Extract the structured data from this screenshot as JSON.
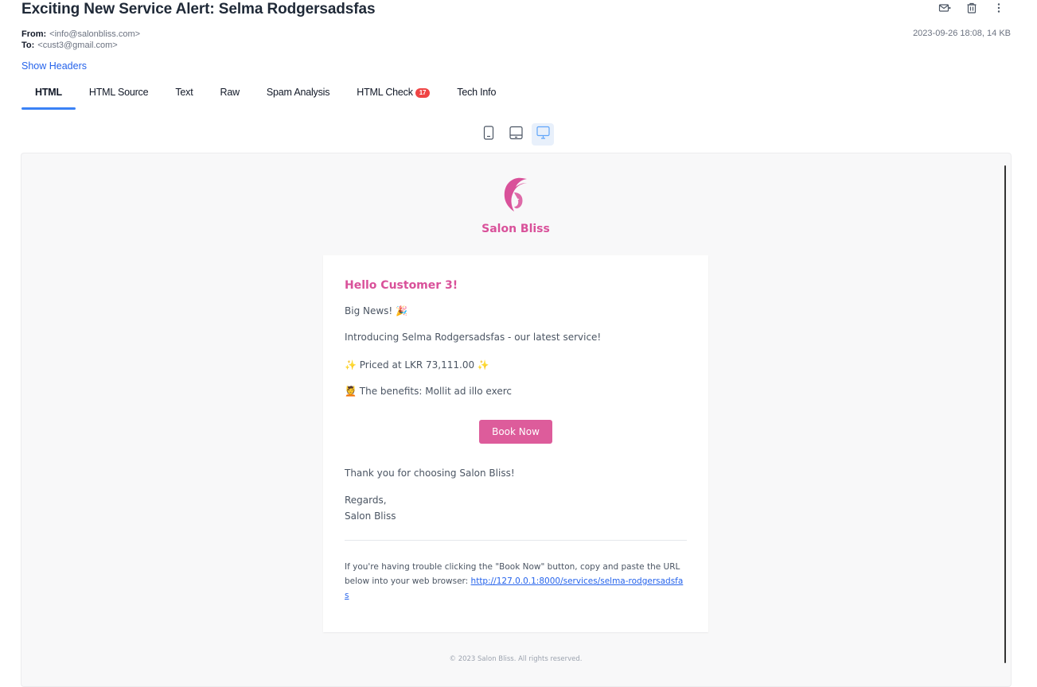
{
  "email": {
    "subject": "Exciting New Service Alert: Selma Rodgersadsfas",
    "from_label": "From:",
    "from_value": "<info@salonbliss.com>",
    "to_label": "To:",
    "to_value": "<cust3@gmail.com>",
    "date_size": "2023-09-26 18:08, 14 KB",
    "show_headers": "Show Headers"
  },
  "actions": {
    "icons": [
      "mark-read-icon",
      "trash-icon",
      "more-vertical-icon"
    ]
  },
  "tabs": [
    {
      "label": "HTML",
      "active": true
    },
    {
      "label": "HTML Source"
    },
    {
      "label": "Text"
    },
    {
      "label": "Raw"
    },
    {
      "label": "Spam Analysis"
    },
    {
      "label": "HTML Check",
      "badge": "17"
    },
    {
      "label": "Tech Info"
    }
  ],
  "devices": {
    "selected": "desktop",
    "icons": [
      "mobile-icon",
      "tablet-icon",
      "desktop-icon"
    ]
  },
  "message": {
    "brand": "Salon Bliss",
    "greeting": "Hello Customer 3!",
    "big_news": "Big News! 🎉",
    "intro": "Introducing Selma Rodgersadsfas - our latest service!",
    "price": "✨ Priced at LKR 73,111.00 ✨",
    "benefits": "💆 The benefits: Mollit ad illo exerc",
    "button": "Book Now",
    "thanks": "Thank you for choosing Salon Bliss!",
    "regards": "Regards,",
    "signature": "Salon Bliss",
    "trouble_text": "If you're having trouble clicking the \"Book Now\" button, copy and paste the URL below into your web browser:",
    "trouble_url": "http://127.0.0.1:8000/services/selma-rodgersadsfas",
    "footer": "© 2023 Salon Bliss. All rights reserved."
  },
  "colors": {
    "brand_pink": "#d9519a",
    "accent_blue": "#3b82f6",
    "badge_red": "#ef4444"
  }
}
